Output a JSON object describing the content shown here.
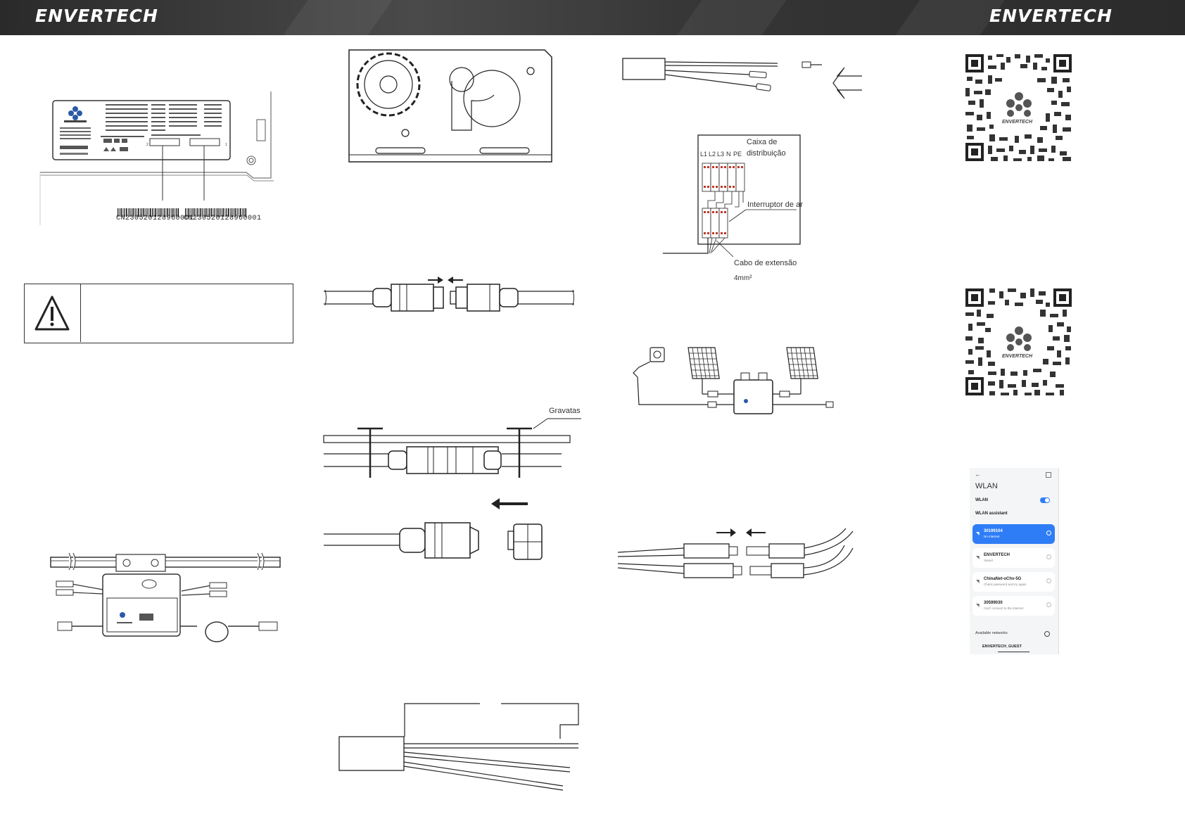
{
  "header": {
    "brand_left": "ENVERTECH",
    "brand_right": "ENVERTECH"
  },
  "colors": {
    "header_bg": "#3a3a3a",
    "accent": "#2f7df6",
    "line": "#333333"
  },
  "nameplate": {
    "barcode_1": "CN230520128960001",
    "barcode_2": "CN230520128960001"
  },
  "warning": {
    "icon": "warning-triangle-icon"
  },
  "labels": {
    "gravatas": "Gravatas",
    "caixa_distribuicao_1": "Caixa de",
    "caixa_distribuicao_2": "distribuição",
    "interruptor": "Interruptor de ar",
    "cabo_extensao": "Cabo de extensão",
    "cabo_secao": "4mm²",
    "terminals": [
      "L1",
      "L2",
      "L3",
      "N",
      "PE"
    ]
  },
  "qr_codes": {
    "logo_text_1": "ENVERTECH",
    "logo_text_2": "ENVERTECH"
  },
  "phone": {
    "back": "←",
    "title": "WLAN",
    "wlan_label": "WLAN",
    "wlan_enabled": true,
    "assistant_label": "WLAN assistant",
    "networks": [
      {
        "name": "30199104",
        "status": "No Internet",
        "active": true
      },
      {
        "name": "ENVERTECH",
        "status": "Saved",
        "active": false
      },
      {
        "name": "ChinaNet-oChv-5G",
        "status": "Check password and try again",
        "active": false
      },
      {
        "name": "30599030",
        "status": "Can't connect to the internet",
        "active": false
      }
    ],
    "available_label": "Available networks",
    "guest_network": "ENVERTECH_GUEST"
  }
}
